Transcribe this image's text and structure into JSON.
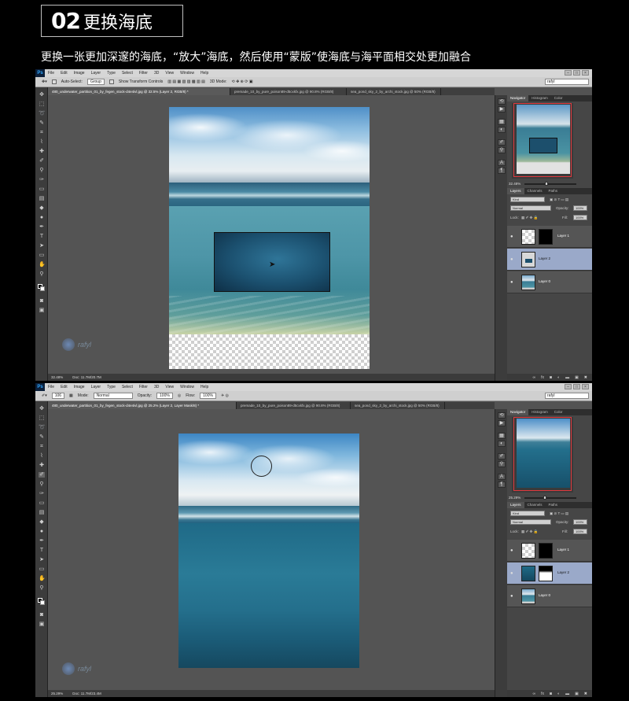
{
  "header": {
    "step_number": "02",
    "step_title": "更换海底",
    "subtitle": "更换一张更加深邃的海底，“放大”海底，然后使用“蒙版”使海底与海平面相交处更加融合"
  },
  "app": {
    "logo": "Ps",
    "menu": [
      "File",
      "Edit",
      "Image",
      "Layer",
      "Type",
      "Select",
      "Filter",
      "3D",
      "View",
      "Window",
      "Help"
    ],
    "workspace": "rafyl"
  },
  "screen1": {
    "options": {
      "auto_select": "Auto-Select:",
      "group": "Group",
      "transform": "Show Transform Controls",
      "mode3d": "3D Mode:"
    },
    "tabs": [
      "480_underwater_partition_01_by_fegen_stock-d4e4ivl.jpg @ 32.5% (Layer 2, RGB/8) *",
      "premade_10_by_pure_poison89-d5cxkfx.jpg @ 90.8% (RGB/8)",
      "sea_pond_sky_2_by_archi_stock.jpg @ 50% (RGB/8)"
    ],
    "status": {
      "zoom": "32.48%",
      "doc": "Doc: 11.7M/20.7M"
    },
    "navigator": {
      "tabs": [
        "Navigator",
        "Histogram",
        "Color"
      ],
      "zoom": "32.48%"
    },
    "layers_panel": {
      "tabs": [
        "Layers",
        "Channels",
        "Paths"
      ],
      "kind": "Kind",
      "blend": "Normal",
      "opacity_label": "Opacity:",
      "opacity": "100%",
      "lock_label": "Lock:",
      "fill_label": "Fill:",
      "fill": "100%",
      "layers": [
        {
          "name": "Layer 1",
          "selected": false
        },
        {
          "name": "Layer 2",
          "selected": true
        },
        {
          "name": "Layer 0",
          "selected": false
        }
      ]
    }
  },
  "screen2": {
    "options": {
      "mode_label": "Mode:",
      "mode": "Normal",
      "opacity_label": "Opacity:",
      "opacity": "100%",
      "flow_label": "Flow:",
      "flow": "100%",
      "brush_size": "106"
    },
    "tabs": [
      "480_underwater_partition_01_by_fegen_stock-d4e4ivl.jpg @ 25.2% (Layer 2, Layer Mask/8) *",
      "premade_10_by_pure_poison89-d5cxkfx.jpg @ 90.8% (RGB/8)",
      "sea_pond_sky_2_by_archi_stock.jpg @ 50% (RGB/8)"
    ],
    "status": {
      "zoom": "25.29%",
      "doc": "Doc: 11.7M/23.4M"
    },
    "navigator": {
      "tabs": [
        "Navigator",
        "Histogram",
        "Color"
      ],
      "zoom": "25.29%"
    },
    "layers_panel": {
      "tabs": [
        "Layers",
        "Channels",
        "Paths"
      ],
      "kind": "Kind",
      "blend": "Normal",
      "opacity_label": "Opacity:",
      "opacity": "100%",
      "lock_label": "Lock:",
      "fill_label": "Fill:",
      "fill": "100%",
      "layers": [
        {
          "name": "Layer 1",
          "selected": false
        },
        {
          "name": "Layer 2",
          "selected": true
        },
        {
          "name": "Layer 0",
          "selected": false
        }
      ]
    }
  },
  "watermark": "rafyl"
}
